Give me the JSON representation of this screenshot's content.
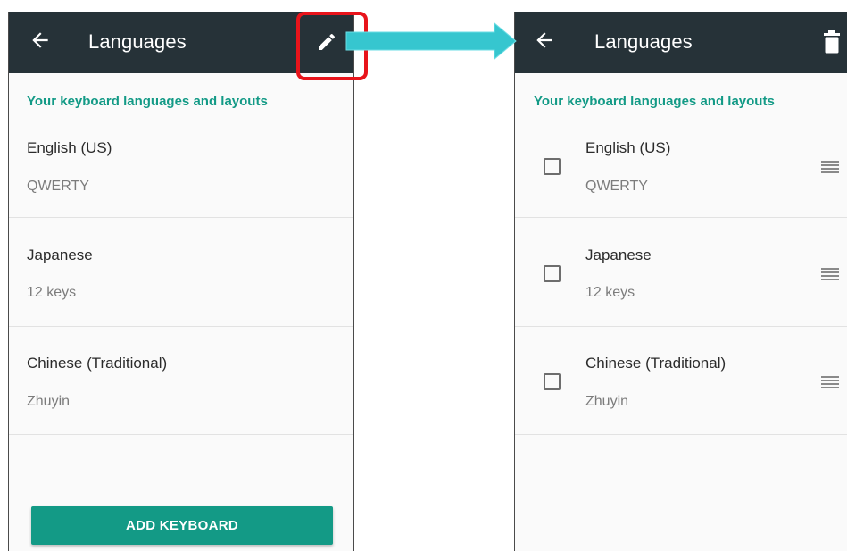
{
  "colors": {
    "appbar": "#263238",
    "accent": "#139a86",
    "highlight": "#e8141b",
    "arrow": "#36c6cf"
  },
  "icons": {
    "back": "arrow-left-icon",
    "edit": "pencil-icon",
    "delete": "trash-icon",
    "drag": "drag-handle-icon",
    "select": "checkbox-icon"
  },
  "left_screen": {
    "title": "Languages",
    "section_header": "Your keyboard languages and layouts",
    "keyboards": [
      {
        "name": "English (US)",
        "layout": "QWERTY"
      },
      {
        "name": "Japanese",
        "layout": "12 keys"
      },
      {
        "name": "Chinese (Traditional)",
        "layout": "Zhuyin"
      }
    ],
    "add_button": "ADD KEYBOARD"
  },
  "right_screen": {
    "title": "Languages",
    "section_header": "Your keyboard languages and layouts",
    "keyboards": [
      {
        "name": "English (US)",
        "layout": "QWERTY",
        "checked": false
      },
      {
        "name": "Japanese",
        "layout": "12 keys",
        "checked": false
      },
      {
        "name": "Chinese (Traditional)",
        "layout": "Zhuyin",
        "checked": false
      }
    ]
  }
}
